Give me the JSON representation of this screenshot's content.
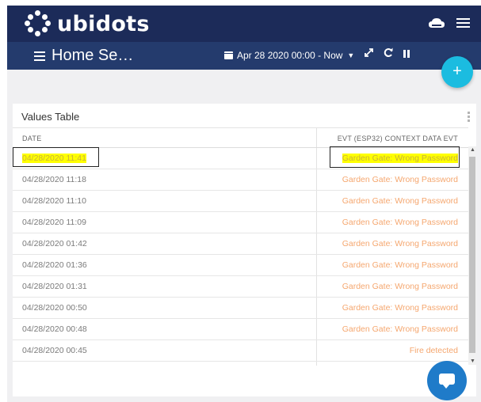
{
  "app": {
    "logo_text": "ubidots"
  },
  "dashboard": {
    "title": "Home Se…"
  },
  "date_range": {
    "label": "Apr 28 2020 00:00 - Now"
  },
  "add_button": {
    "label": "+"
  },
  "widget": {
    "title": "Values Table",
    "columns": [
      "DATE",
      "EVT (ESP32) CONTEXT DATA EVT"
    ],
    "rows": [
      {
        "date": "04/28/2020 11:41",
        "value": "Garden Gate: Wrong Password",
        "highlighted": true
      },
      {
        "date": "04/28/2020 11:18",
        "value": "Garden Gate: Wrong Password"
      },
      {
        "date": "04/28/2020 11:10",
        "value": "Garden Gate: Wrong Password"
      },
      {
        "date": "04/28/2020 11:09",
        "value": "Garden Gate: Wrong Password"
      },
      {
        "date": "04/28/2020 01:42",
        "value": "Garden Gate: Wrong Password"
      },
      {
        "date": "04/28/2020 01:36",
        "value": "Garden Gate: Wrong Password"
      },
      {
        "date": "04/28/2020 01:31",
        "value": "Garden Gate: Wrong Password"
      },
      {
        "date": "04/28/2020 00:50",
        "value": "Garden Gate: Wrong Password"
      },
      {
        "date": "04/28/2020 00:48",
        "value": "Garden Gate: Wrong Password"
      },
      {
        "date": "04/28/2020 00:45",
        "value": "Fire detected"
      }
    ]
  },
  "colors": {
    "topbar": "#1c2b59",
    "subbar": "#243b6d",
    "accent": "#1bbce0",
    "value_text": "#f5a76f",
    "highlight": "#ffff00",
    "chat_button": "#1f7bc9"
  },
  "icons": {
    "logo": "ubidots-dots-icon",
    "cloud": "cloud-icon",
    "menu": "hamburger-menu-icon",
    "calendar": "calendar-icon",
    "expand": "expand-icon",
    "refresh": "refresh-icon",
    "pause": "pause-icon",
    "options": "kebab-menu-icon",
    "chat": "chat-icon"
  }
}
